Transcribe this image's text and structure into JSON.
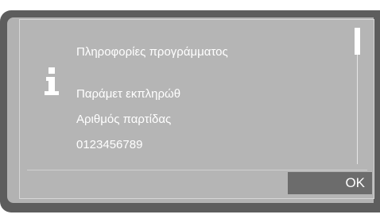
{
  "dialog": {
    "title": "Πληροφορίες προγράμματος",
    "lines": [
      "Παράμετ εκπληρώθ",
      "Αριθμός παρτίδας",
      "0123456789"
    ],
    "ok_label": "OK"
  },
  "colors": {
    "frame": "#5d5d5d",
    "screen": "#b2b2b2",
    "button": "#6c6c6c",
    "text": "#ffffff"
  },
  "icons": {
    "info": "info-icon"
  }
}
